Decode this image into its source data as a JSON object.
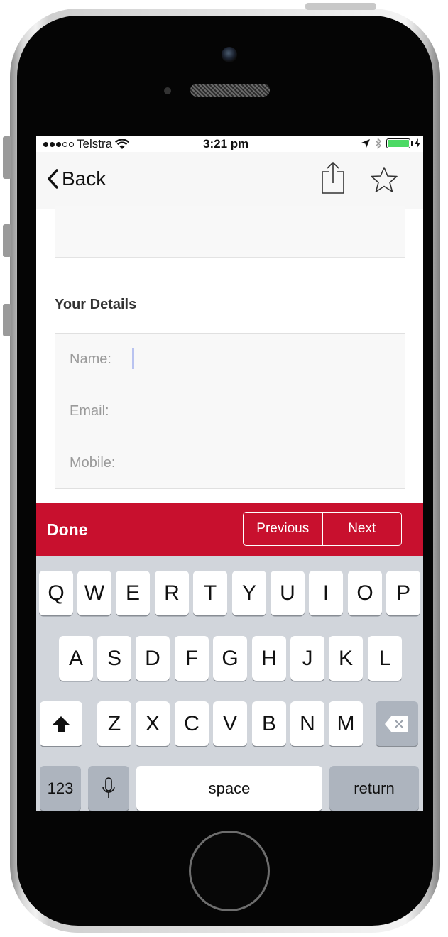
{
  "status_bar": {
    "carrier": "Telstra",
    "time": "3:21 pm",
    "battery_color": "#4cd964"
  },
  "nav": {
    "back_label": "Back",
    "icons": [
      "chevron-left-icon",
      "share-icon",
      "star-icon"
    ]
  },
  "form": {
    "section_title": "Your Details",
    "fields": [
      {
        "label": "Name:",
        "value": ""
      },
      {
        "label": "Email:",
        "value": ""
      },
      {
        "label": "Mobile:",
        "value": ""
      }
    ]
  },
  "accessory": {
    "done_label": "Done",
    "previous_label": "Previous",
    "next_label": "Next",
    "accent_color": "#c8102e"
  },
  "keyboard": {
    "row1": [
      "Q",
      "W",
      "E",
      "R",
      "T",
      "Y",
      "U",
      "I",
      "O",
      "P"
    ],
    "row2": [
      "A",
      "S",
      "D",
      "F",
      "G",
      "H",
      "J",
      "K",
      "L"
    ],
    "row3": [
      "Z",
      "X",
      "C",
      "V",
      "B",
      "N",
      "M"
    ],
    "numbers_label": "123",
    "space_label": "space",
    "return_label": "return"
  }
}
